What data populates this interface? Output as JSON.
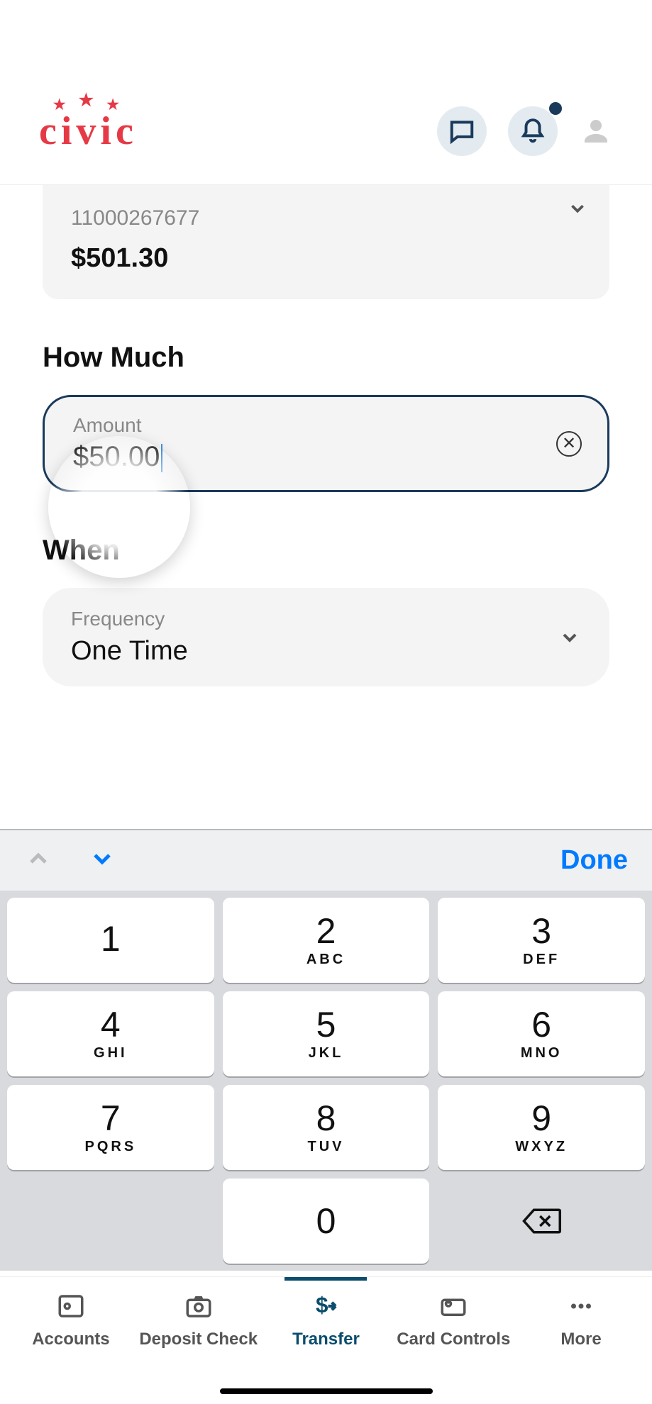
{
  "header": {
    "brand": "civic"
  },
  "account": {
    "number": "11000267677",
    "balance": "$501.30"
  },
  "sections": {
    "how_much_title": "How Much",
    "amount_label": "Amount",
    "amount_value": "$50.00",
    "when_title": "When",
    "frequency_label": "Frequency",
    "frequency_value": "One Time"
  },
  "keyboard": {
    "done": "Done",
    "keys": [
      {
        "n": "1",
        "l": ""
      },
      {
        "n": "2",
        "l": "ABC"
      },
      {
        "n": "3",
        "l": "DEF"
      },
      {
        "n": "4",
        "l": "GHI"
      },
      {
        "n": "5",
        "l": "JKL"
      },
      {
        "n": "6",
        "l": "MNO"
      },
      {
        "n": "7",
        "l": "PQRS"
      },
      {
        "n": "8",
        "l": "TUV"
      },
      {
        "n": "9",
        "l": "WXYZ"
      }
    ],
    "zero": "0"
  },
  "tabs": {
    "accounts": "Accounts",
    "deposit": "Deposit Check",
    "transfer": "Transfer",
    "card": "Card Controls",
    "more": "More"
  }
}
